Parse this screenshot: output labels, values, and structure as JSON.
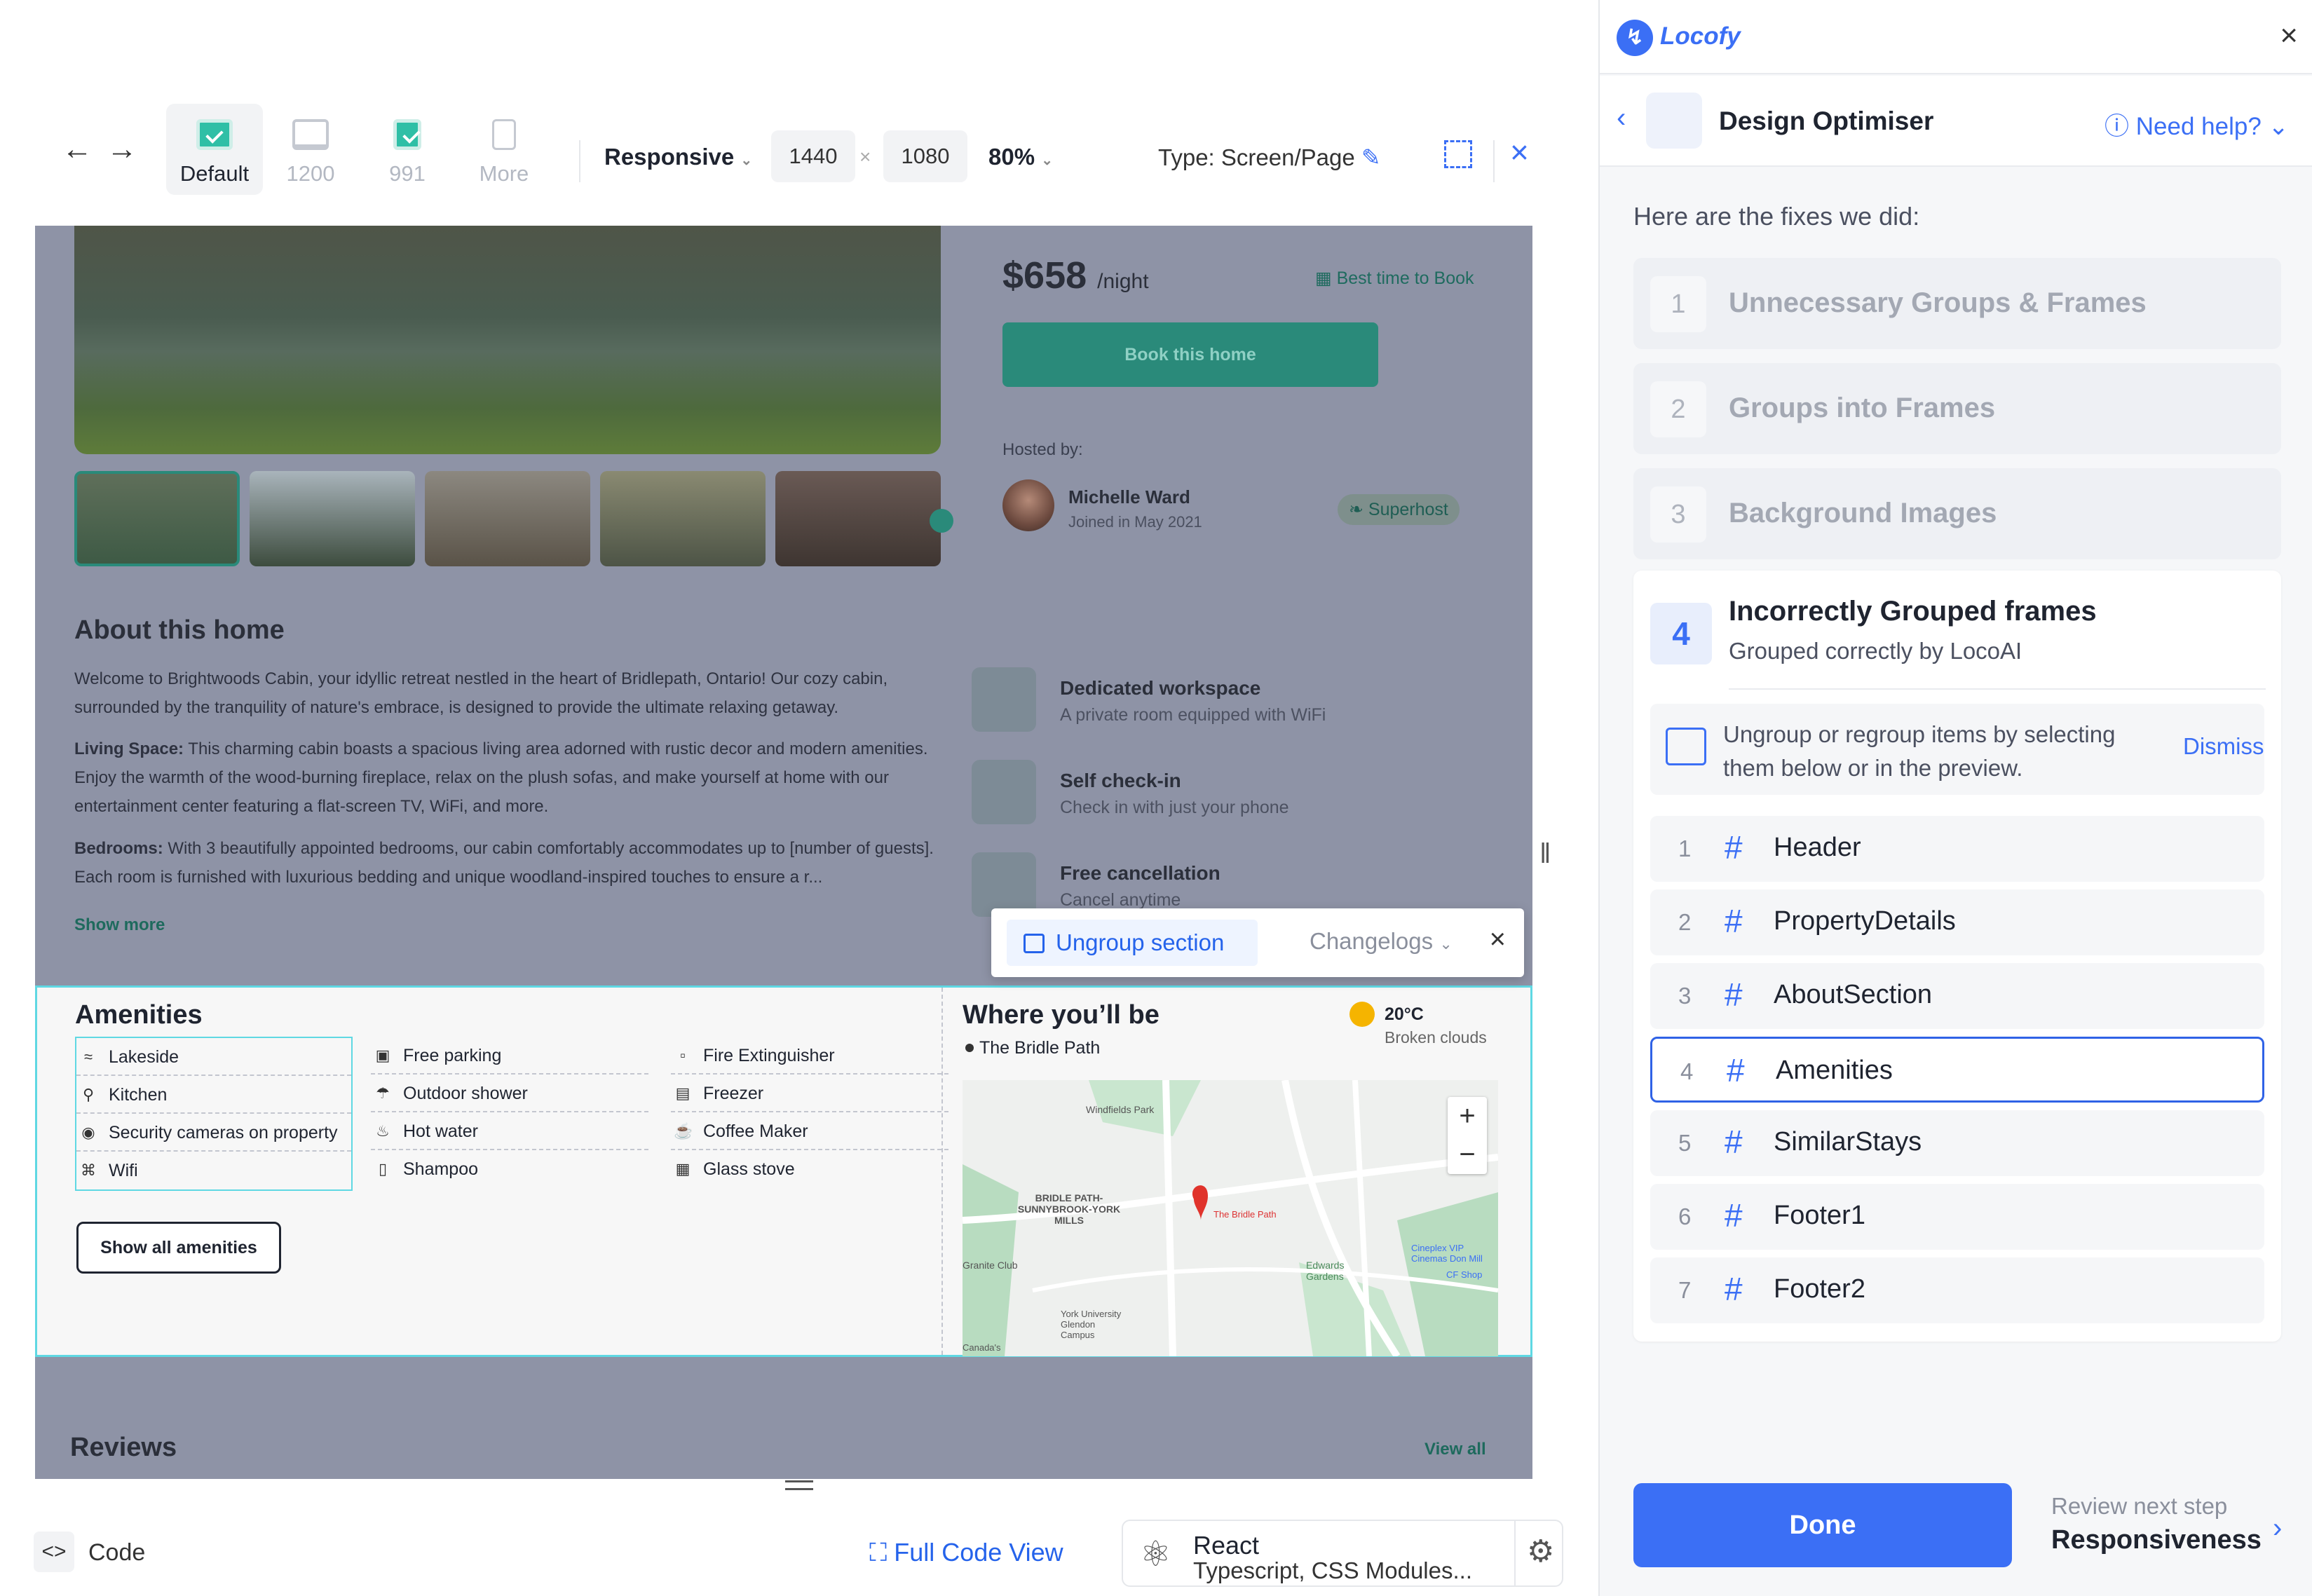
{
  "toolbar": {
    "back_icon": "arrow-left-icon",
    "forward_icon": "arrow-right-icon",
    "breakpoints": [
      "Default",
      "1200",
      "991",
      "More"
    ],
    "mode": "Responsive",
    "width": "1440",
    "height": "1080",
    "times": "×",
    "zoom": "80%",
    "type_label": "Type:",
    "type_value": "Screen/Page"
  },
  "canvas": {
    "price": "$658",
    "per_night": "/night",
    "best_time": "Best time to Book",
    "book_button": "Book this home",
    "hosted_by": "Hosted by:",
    "host_name": "Michelle Ward",
    "host_joined": "Joined in May 2021",
    "superhost": "Superhost",
    "about_title": "About this home",
    "about_intro": "Welcome to Brightwoods Cabin, your idyllic retreat nestled in the heart of Bridlepath, Ontario! Our cozy cabin, surrounded by the tranquility of nature's embrace, is designed to provide the ultimate relaxing getaway.",
    "living_label": "Living Space:",
    "living_text": " This charming cabin boasts a spacious living area adorned with rustic decor and modern amenities. Enjoy the warmth of the wood-burning fireplace, relax on the plush sofas, and make yourself at home with our entertainment center featuring a flat-screen TV, WiFi, and more.",
    "bedrooms_label": "Bedrooms:",
    "bedrooms_text": " With 3 beautifully appointed bedrooms, our cabin comfortably accommodates up to [number of guests]. Each room is furnished with luxurious bedding and unique woodland-inspired touches to ensure a r...",
    "show_more": "Show more",
    "features": [
      {
        "title": "Dedicated workspace",
        "sub": "A private room equipped with WiFi"
      },
      {
        "title": "Self check-in",
        "sub": "Check in with just your phone"
      },
      {
        "title": "Free cancellation",
        "sub": "Cancel anytime"
      }
    ],
    "amenities_title": "Amenities",
    "amenities": [
      [
        "Lakeside",
        "Kitchen",
        "Security cameras on property",
        "Wifi"
      ],
      [
        "Free parking",
        "Outdoor shower",
        "Hot water",
        "Shampoo"
      ],
      [
        "Fire Extinguisher",
        "Freezer",
        "Coffee Maker",
        "Glass stove"
      ]
    ],
    "show_all": "Show all amenities",
    "where_title": "Where you’ll be",
    "location": "The Bridle Path",
    "temperature": "20°C",
    "weather": "Broken clouds",
    "map_labels": {
      "windfields": "Windfields Park",
      "bridle_area": "BRIDLE PATH-SUNNYBROOK-YORK MILLS",
      "pin": "The Bridle Path",
      "granite": "Granite Club",
      "edwards": "Edwards Gardens",
      "york": "York University Glendon Campus",
      "cineplex": "Cineplex VIP Cinemas Don Mill",
      "cf": "CF Shop",
      "canada": "Canada's"
    },
    "reviews_title": "Reviews",
    "view_all": "View all"
  },
  "popup": {
    "ungroup": "Ungroup section",
    "changelogs": "Changelogs"
  },
  "bottom": {
    "code": "Code",
    "full_code": "Full Code View",
    "framework": "React",
    "framework_sub": "Typescript, CSS Modules..."
  },
  "panel": {
    "brand": "Locofy",
    "title": "Design Optimiser",
    "help": "Need help?",
    "fixes_intro": "Here are the fixes we did:",
    "steps": [
      {
        "num": "1",
        "label": "Unnecessary Groups & Frames"
      },
      {
        "num": "2",
        "label": "Groups into Frames"
      },
      {
        "num": "3",
        "label": "Background Images"
      }
    ],
    "active_step": {
      "num": "4",
      "title": "Incorrectly Grouped frames",
      "sub": "Grouped correctly by LocoAI"
    },
    "info": "Ungroup or regroup items by selecting them below or in the preview.",
    "dismiss": "Dismiss",
    "frames": [
      {
        "num": "1",
        "name": "Header"
      },
      {
        "num": "2",
        "name": "PropertyDetails"
      },
      {
        "num": "3",
        "name": "AboutSection"
      },
      {
        "num": "4",
        "name": "Amenities"
      },
      {
        "num": "5",
        "name": "SimilarStays"
      },
      {
        "num": "6",
        "name": "Footer1"
      },
      {
        "num": "7",
        "name": "Footer2"
      }
    ],
    "done": "Done",
    "next_label": "Review next step",
    "next_step": "Responsiveness"
  },
  "colors": {
    "accent": "#3b6ff5",
    "teal": "#2fbfa6",
    "selection": "#5fd8e3"
  }
}
